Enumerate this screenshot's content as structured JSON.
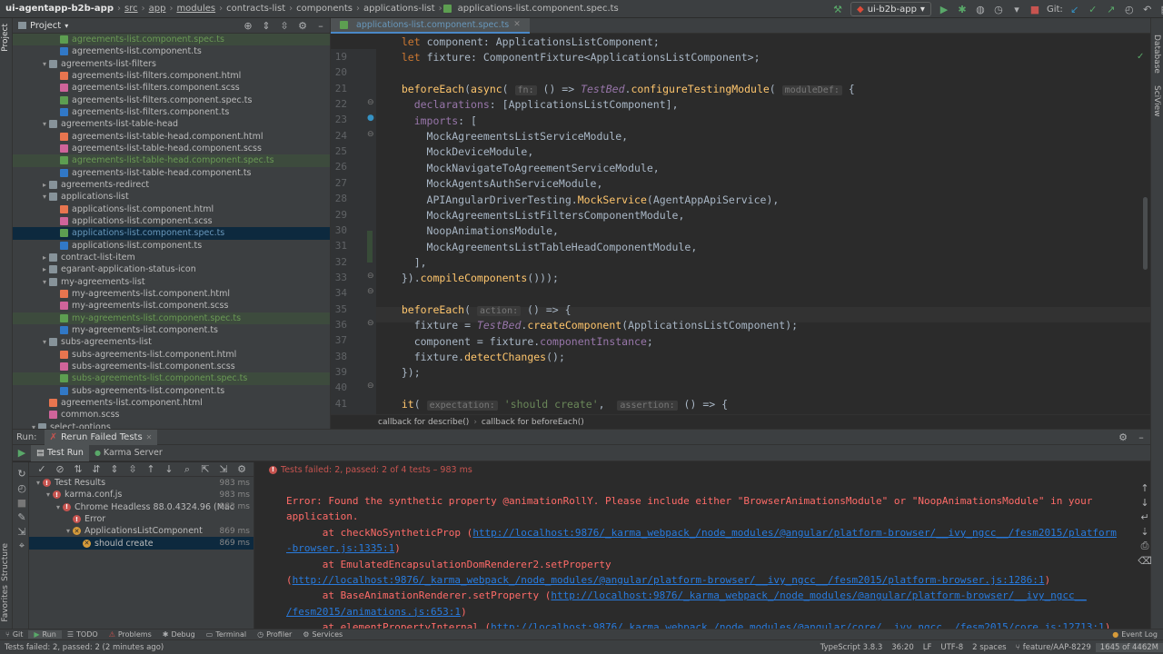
{
  "breadcrumb": {
    "project": "ui-agentapp-b2b-app",
    "path": [
      "src",
      "app",
      "modules",
      "contracts-list",
      "components",
      "applications-list"
    ],
    "file": "applications-list.component.spec.ts"
  },
  "toolbar": {
    "run_config": "ui-b2b-app",
    "git_label": "Git:"
  },
  "left_tool": {
    "project": "Project",
    "structure": "Structure",
    "favorites": "Favorites"
  },
  "right_tool": {
    "database": "Database",
    "sciview": "SciView"
  },
  "project_panel": {
    "title": "Project",
    "items": [
      {
        "label": "agreements-list.component.spec.ts",
        "type": "spec",
        "indent": 3,
        "state": "green"
      },
      {
        "label": "agreements-list.component.ts",
        "type": "ts",
        "indent": 3,
        "state": ""
      },
      {
        "label": "agreements-list-filters",
        "type": "folder",
        "indent": 2,
        "state": "",
        "open": true
      },
      {
        "label": "agreements-list-filters.component.html",
        "type": "html",
        "indent": 3,
        "state": ""
      },
      {
        "label": "agreements-list-filters.component.scss",
        "type": "scss",
        "indent": 3,
        "state": ""
      },
      {
        "label": "agreements-list-filters.component.spec.ts",
        "type": "spec",
        "indent": 3,
        "state": ""
      },
      {
        "label": "agreements-list-filters.component.ts",
        "type": "ts",
        "indent": 3,
        "state": ""
      },
      {
        "label": "agreements-list-table-head",
        "type": "folder",
        "indent": 2,
        "state": "",
        "open": true
      },
      {
        "label": "agreements-list-table-head.component.html",
        "type": "html",
        "indent": 3,
        "state": ""
      },
      {
        "label": "agreements-list-table-head.component.scss",
        "type": "scss",
        "indent": 3,
        "state": ""
      },
      {
        "label": "agreements-list-table-head.component.spec.ts",
        "type": "spec",
        "indent": 3,
        "state": "green"
      },
      {
        "label": "agreements-list-table-head.component.ts",
        "type": "ts",
        "indent": 3,
        "state": ""
      },
      {
        "label": "agreements-redirect",
        "type": "folder",
        "indent": 2,
        "state": "",
        "open": false
      },
      {
        "label": "applications-list",
        "type": "folder",
        "indent": 2,
        "state": "",
        "open": true
      },
      {
        "label": "applications-list.component.html",
        "type": "html",
        "indent": 3,
        "state": ""
      },
      {
        "label": "applications-list.component.scss",
        "type": "scss",
        "indent": 3,
        "state": ""
      },
      {
        "label": "applications-list.component.spec.ts",
        "type": "spec",
        "indent": 3,
        "state": "selected"
      },
      {
        "label": "applications-list.component.ts",
        "type": "ts",
        "indent": 3,
        "state": ""
      },
      {
        "label": "contract-list-item",
        "type": "folder",
        "indent": 2,
        "state": "",
        "open": false
      },
      {
        "label": "egarant-application-status-icon",
        "type": "folder",
        "indent": 2,
        "state": "",
        "open": false
      },
      {
        "label": "my-agreements-list",
        "type": "folder",
        "indent": 2,
        "state": "",
        "open": true
      },
      {
        "label": "my-agreements-list.component.html",
        "type": "html",
        "indent": 3,
        "state": ""
      },
      {
        "label": "my-agreements-list.component.scss",
        "type": "scss",
        "indent": 3,
        "state": ""
      },
      {
        "label": "my-agreements-list.component.spec.ts",
        "type": "spec",
        "indent": 3,
        "state": "green"
      },
      {
        "label": "my-agreements-list.component.ts",
        "type": "ts",
        "indent": 3,
        "state": ""
      },
      {
        "label": "subs-agreements-list",
        "type": "folder",
        "indent": 2,
        "state": "",
        "open": true
      },
      {
        "label": "subs-agreements-list.component.html",
        "type": "html",
        "indent": 3,
        "state": ""
      },
      {
        "label": "subs-agreements-list.component.scss",
        "type": "scss",
        "indent": 3,
        "state": ""
      },
      {
        "label": "subs-agreements-list.component.spec.ts",
        "type": "spec",
        "indent": 3,
        "state": "green"
      },
      {
        "label": "subs-agreements-list.component.ts",
        "type": "ts",
        "indent": 3,
        "state": ""
      },
      {
        "label": "agreements-list.component.html",
        "type": "html",
        "indent": 2,
        "state": ""
      },
      {
        "label": "common.scss",
        "type": "scss",
        "indent": 2,
        "state": ""
      },
      {
        "label": "select-options",
        "type": "folder",
        "indent": 1,
        "state": "",
        "open": true
      }
    ]
  },
  "editor": {
    "tab": "applications-list.component.spec.ts",
    "lines": [
      {
        "n": "19",
        "html": "  <span class='kw'>let</span> component: ApplicationsListComponent;"
      },
      {
        "n": "20",
        "html": "  <span class='kw'>let</span> fixture: ComponentFixture&lt;ApplicationsListComponent&gt;;"
      },
      {
        "n": "21",
        "html": ""
      },
      {
        "n": "22",
        "html": "  <span class='fn'>beforeEach</span>(<span class='fn'>async</span>( <span class='hint'>fn:</span> () =&gt; <span class='it'>TestBed</span>.<span class='mth'>configureTestingModule</span>( <span class='hint'>moduleDef:</span> {"
      },
      {
        "n": "23",
        "html": "    <span class='prop'>declarations</span>: [ApplicationsListComponent],"
      },
      {
        "n": "24",
        "html": "    <span class='prop'>imports</span>: ["
      },
      {
        "n": "25",
        "html": "      MockAgreementsListServiceModule,"
      },
      {
        "n": "26",
        "html": "      MockDeviceModule,"
      },
      {
        "n": "27",
        "html": "      MockNavigateToAgreementServiceModule,"
      },
      {
        "n": "28",
        "html": "      MockAgentsAuthServiceModule,"
      },
      {
        "n": "29",
        "html": "      APIAngularDriverTesting.<span class='mth'>MockService</span>(AgentAppApiService),"
      },
      {
        "n": "30",
        "html": "      MockAgreementsListFiltersComponentModule,"
      },
      {
        "n": "31",
        "html": "      NoopAnimationsModule,"
      },
      {
        "n": "32",
        "html": "      MockAgreementsListTableHeadComponentModule,"
      },
      {
        "n": "33",
        "html": "    ],"
      },
      {
        "n": "34",
        "html": "  }).<span class='mth'>compileComponents</span>()));"
      },
      {
        "n": "35",
        "html": ""
      },
      {
        "n": "36",
        "html": "  <span class='fn'>beforeEach</span>( <span class='hint'>action:</span> () =&gt; {"
      },
      {
        "n": "37",
        "html": "    fixture = <span class='it'>TestBed</span>.<span class='mth'>createComponent</span>(ApplicationsListComponent);"
      },
      {
        "n": "38",
        "html": "    component = fixture.<span class='prop'>componentInstance</span>;"
      },
      {
        "n": "39",
        "html": "    fixture.<span class='mth'>detectChanges</span>();"
      },
      {
        "n": "40",
        "html": "  });"
      },
      {
        "n": "41",
        "html": ""
      },
      {
        "n": "42",
        "html": "  <span class='fn'>it</span>( <span class='hint'>expectation:</span> <span class='str'>'should create'</span>,  <span class='hint'>assertion:</span> () =&gt; {"
      }
    ],
    "breadcrumb": [
      "callback for describe()",
      "callback for beforeEach()"
    ]
  },
  "run": {
    "label": "Run:",
    "tab": "Rerun Failed Tests",
    "subtabs": [
      "Test Run",
      "Karma Server"
    ],
    "summary": "Tests failed: 2, passed: 2 of 4 tests – 983 ms",
    "tree": [
      {
        "label": "Test Results",
        "time": "983 ms",
        "indent": 1,
        "icon": "err",
        "sel": false
      },
      {
        "label": "karma.conf.js",
        "time": "983 ms",
        "indent": 2,
        "icon": "err",
        "sel": false
      },
      {
        "label": "Chrome Headless 88.0.4324.96 (Mac",
        "time": "983 ms",
        "indent": 3,
        "icon": "err",
        "sel": false
      },
      {
        "label": "Error",
        "time": "",
        "indent": 4,
        "icon": "err",
        "sel": false
      },
      {
        "label": "ApplicationsListComponent",
        "time": "869 ms",
        "indent": 4,
        "icon": "warn",
        "sel": false
      },
      {
        "label": "should create",
        "time": "869 ms",
        "indent": 5,
        "icon": "warn",
        "sel": true
      }
    ],
    "console": {
      "error_line1": "Error: Found the synthetic property @animationRollY. Please include either \"BrowserAnimationsModule\" or \"NoopAnimationsModule\" in your",
      "error_line2": "application.",
      "at1_prefix": "      at checkNoSyntheticProp (",
      "at1_link": "http://localhost:9876/_karma_webpack_/node_modules/@angular/platform-browser/__ivy_ngcc__/fesm2015/platform",
      "at1_link2": "-browser.js:1335:1",
      "at1_suffix": ")",
      "at2": "      at EmulatedEncapsulationDomRenderer2.setProperty",
      "at2_link": "http://localhost:9876/_karma_webpack_/node_modules/@angular/platform-browser/__ivy_ngcc__/fesm2015/platform-browser.js:1286:1",
      "at3_prefix": "      at BaseAnimationRenderer.setProperty (",
      "at3_link": "http://localhost:9876/_karma_webpack_/node_modules/@angular/platform-browser/__ivy_ngcc__",
      "at3_link2": "/fesm2015/animations.js:653:1",
      "at4_prefix": "      at elementPropertyInternal (",
      "at4_link": "http://localhost:9876/_karma_webpack_/node_modules/@angular/core/__ivy_ngcc__/fesm2015/core.js:12713:1"
    }
  },
  "bottom_tabs": [
    "Git",
    "Run",
    "TODO",
    "Problems",
    "Debug",
    "Terminal",
    "Profiler",
    "Services"
  ],
  "event_log": "Event Log",
  "status": {
    "message": "Tests failed: 2, passed: 2 (2 minutes ago)",
    "language": "TypeScript 3.8.3",
    "position": "36:20",
    "line_sep": "LF",
    "encoding": "UTF-8",
    "indent": "2 spaces",
    "branch": "feature/AAP-8229",
    "memory": "1645 of 4462M"
  },
  "colors": {
    "error": "#c75450",
    "warning": "#d69b3a",
    "link": "#287bde",
    "accent": "#4a88c7"
  }
}
